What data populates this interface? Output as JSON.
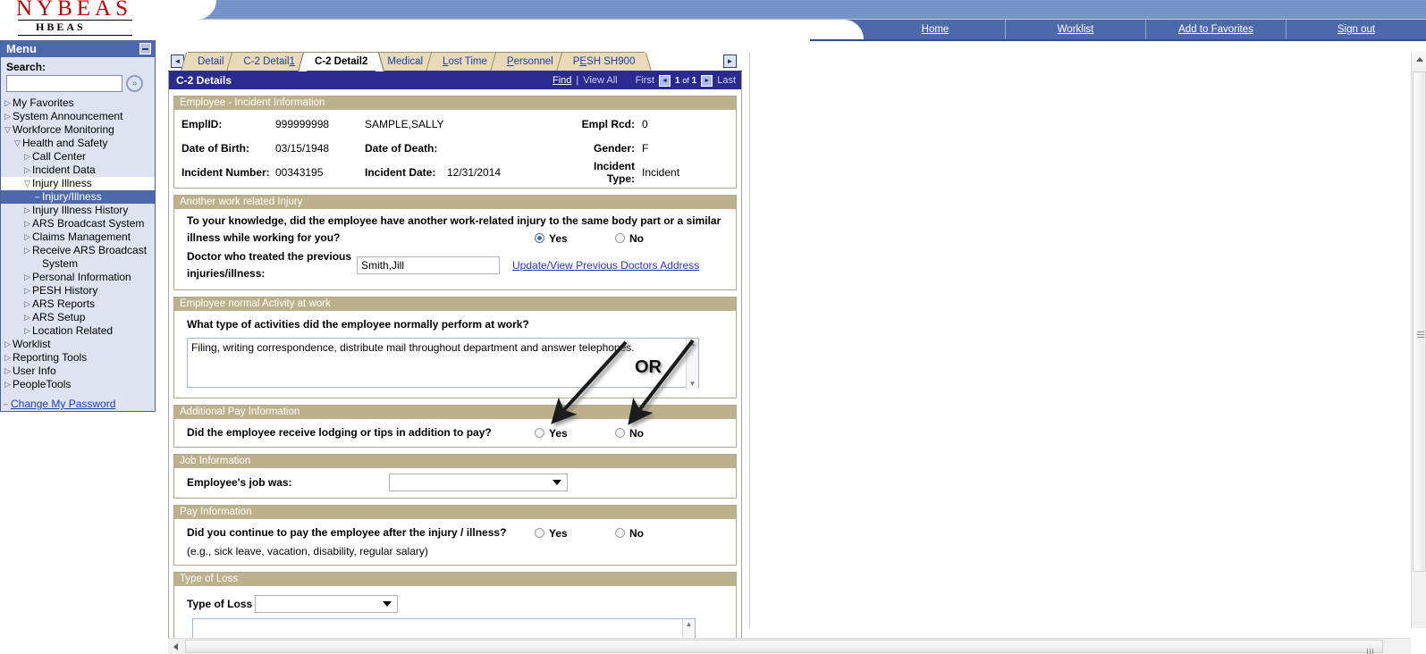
{
  "brand": {
    "primary": "NYBEAS",
    "secondary": "HBEAS"
  },
  "topnav": {
    "links": [
      {
        "label": "Home",
        "name": "nav-home"
      },
      {
        "label": "Worklist",
        "name": "nav-worklist"
      },
      {
        "label": "Add to Favorites",
        "name": "nav-add-to-favorites"
      },
      {
        "label": "Sign out",
        "name": "nav-sign-out"
      }
    ]
  },
  "sidebar": {
    "title": "Menu",
    "search_label": "Search:",
    "search_value": "",
    "search_button_icon": "double-chevron-right-icon",
    "tree": [
      {
        "label": "My Favorites",
        "indent": 0,
        "marker": "collapsed",
        "state": "normal"
      },
      {
        "label": "System Announcement",
        "indent": 0,
        "marker": "collapsed",
        "state": "normal"
      },
      {
        "label": "Workforce Monitoring",
        "indent": 0,
        "marker": "expanded",
        "state": "normal"
      },
      {
        "label": "Health and Safety",
        "indent": 1,
        "marker": "expanded",
        "state": "normal"
      },
      {
        "label": "Call Center",
        "indent": 2,
        "marker": "collapsed",
        "state": "normal"
      },
      {
        "label": "Incident Data",
        "indent": 2,
        "marker": "collapsed",
        "state": "normal"
      },
      {
        "label": "Injury Illness",
        "indent": 2,
        "marker": "expanded",
        "state": "open-white"
      },
      {
        "label": "Injury/Illness",
        "indent": 3,
        "marker": "leaf",
        "state": "selected"
      },
      {
        "label": "Injury Illness History",
        "indent": 2,
        "marker": "collapsed",
        "state": "normal"
      },
      {
        "label": "ARS Broadcast System",
        "indent": 2,
        "marker": "collapsed",
        "state": "normal"
      },
      {
        "label": "Claims Management",
        "indent": 2,
        "marker": "collapsed",
        "state": "normal"
      },
      {
        "label": "Receive ARS Broadcast",
        "indent": 2,
        "marker": "collapsed",
        "state": "normal"
      },
      {
        "label": "System",
        "indent": 3,
        "marker": "none",
        "state": "normal"
      },
      {
        "label": "Personal Information",
        "indent": 2,
        "marker": "collapsed",
        "state": "normal"
      },
      {
        "label": "PESH History",
        "indent": 2,
        "marker": "collapsed",
        "state": "normal"
      },
      {
        "label": "ARS Reports",
        "indent": 2,
        "marker": "collapsed",
        "state": "normal"
      },
      {
        "label": "ARS Setup",
        "indent": 2,
        "marker": "collapsed",
        "state": "normal"
      },
      {
        "label": "Location Related",
        "indent": 2,
        "marker": "collapsed",
        "state": "normal"
      },
      {
        "label": "Worklist",
        "indent": 0,
        "marker": "collapsed",
        "state": "normal"
      },
      {
        "label": "Reporting Tools",
        "indent": 0,
        "marker": "collapsed",
        "state": "normal"
      },
      {
        "label": "User Info",
        "indent": 0,
        "marker": "collapsed",
        "state": "normal"
      },
      {
        "label": "PeopleTools",
        "indent": 0,
        "marker": "collapsed",
        "state": "normal"
      }
    ],
    "change_password": "Change My Password"
  },
  "tabs": {
    "prev_icon": "left-triangle-icon",
    "next_icon": "right-triangle-icon",
    "items": [
      {
        "label": "Detail",
        "accel": "",
        "active": false
      },
      {
        "label": "C-2 Detail1",
        "accel": "1",
        "active": false
      },
      {
        "label": "C-2 Detail2",
        "accel": "",
        "active": true
      },
      {
        "label": "Medical",
        "accel": "",
        "active": false
      },
      {
        "label": "Lost Time",
        "accel": "L",
        "active": false
      },
      {
        "label": "Personnel",
        "accel": "P",
        "active": false
      },
      {
        "label": "PESH SH900",
        "accel": "E",
        "active": false
      }
    ]
  },
  "panel": {
    "title": "C-2 Details",
    "find_label": "Find",
    "separator": "|",
    "view_all_label": "View All",
    "first_label": "First",
    "last_label": "Last",
    "prev_icon": "left-triangle-icon",
    "next_icon": "right-triangle-icon",
    "page_current": "1",
    "page_of": "of",
    "page_total": "1"
  },
  "employee_section": {
    "title": "Employee - Incident Information",
    "fields": {
      "emplid_label": "EmplID:",
      "emplid_value": "999999998",
      "name_value": "SAMPLE,SALLY",
      "empl_rcd_label": "Empl Rcd:",
      "empl_rcd_value": "0",
      "dob_label": "Date of Birth:",
      "dob_value": "03/15/1948",
      "dod_label": "Date of Death:",
      "dod_value": "",
      "gender_label": "Gender:",
      "gender_value": "F",
      "incident_number_label": "Incident Number:",
      "incident_number_value": "00343195",
      "incident_date_label": "Incident Date:",
      "incident_date_value": "12/31/2014",
      "incident_type_label": "Incident Type:",
      "incident_type_value": "Incident"
    }
  },
  "another_injury_section": {
    "title": "Another work related Injury",
    "question_line1": "To your knowledge, did the employee have another work-related injury to the same body part or a similar",
    "question_line2": "illness while working for you?",
    "yes_label": "Yes",
    "no_label": "No",
    "selected": "Yes",
    "doctor_label_line1": "Doctor who treated the previous",
    "doctor_label_line2": "injuries/illness:",
    "doctor_value": "Smith,Jill",
    "doctor_link": "Update/View Previous Doctors Address"
  },
  "activity_section": {
    "title": "Employee normal Activity at work",
    "question": "What type of activities did the employee normally perform at  work?",
    "textarea_value": "Filing, writing correspondence, distribute mail throughout department and answer telephones."
  },
  "additional_pay_section": {
    "title": "Additional Pay Information",
    "question": "Did the employee receive lodging or tips in addition to pay?",
    "yes_label": "Yes",
    "no_label": "No",
    "selected": ""
  },
  "job_section": {
    "title": "Job Information",
    "label": "Employee's job was:",
    "selected_value": ""
  },
  "pay_section": {
    "title": "Pay Information",
    "question": "Did you continue to pay the employee after the injury / illness?",
    "hint": "(e.g., sick leave, vacation, disability, regular salary)",
    "yes_label": "Yes",
    "no_label": "No",
    "selected": ""
  },
  "loss_section": {
    "title": "Type of Loss",
    "label": "Type of Loss",
    "selected_value": "",
    "textarea_value": ""
  },
  "annotation": {
    "or_text": "OR",
    "arrow_color": "#1a1a1a"
  },
  "colors": {
    "nav_blue": "#4d69ab",
    "panel_header": "#2b2b8f",
    "section_header": "#bcb18c",
    "sidebar_bg": "#dfe3ef",
    "tab_bg": "#e8d9b9",
    "link_blue": "#1b3fb0",
    "logo_red": "#c00000"
  }
}
